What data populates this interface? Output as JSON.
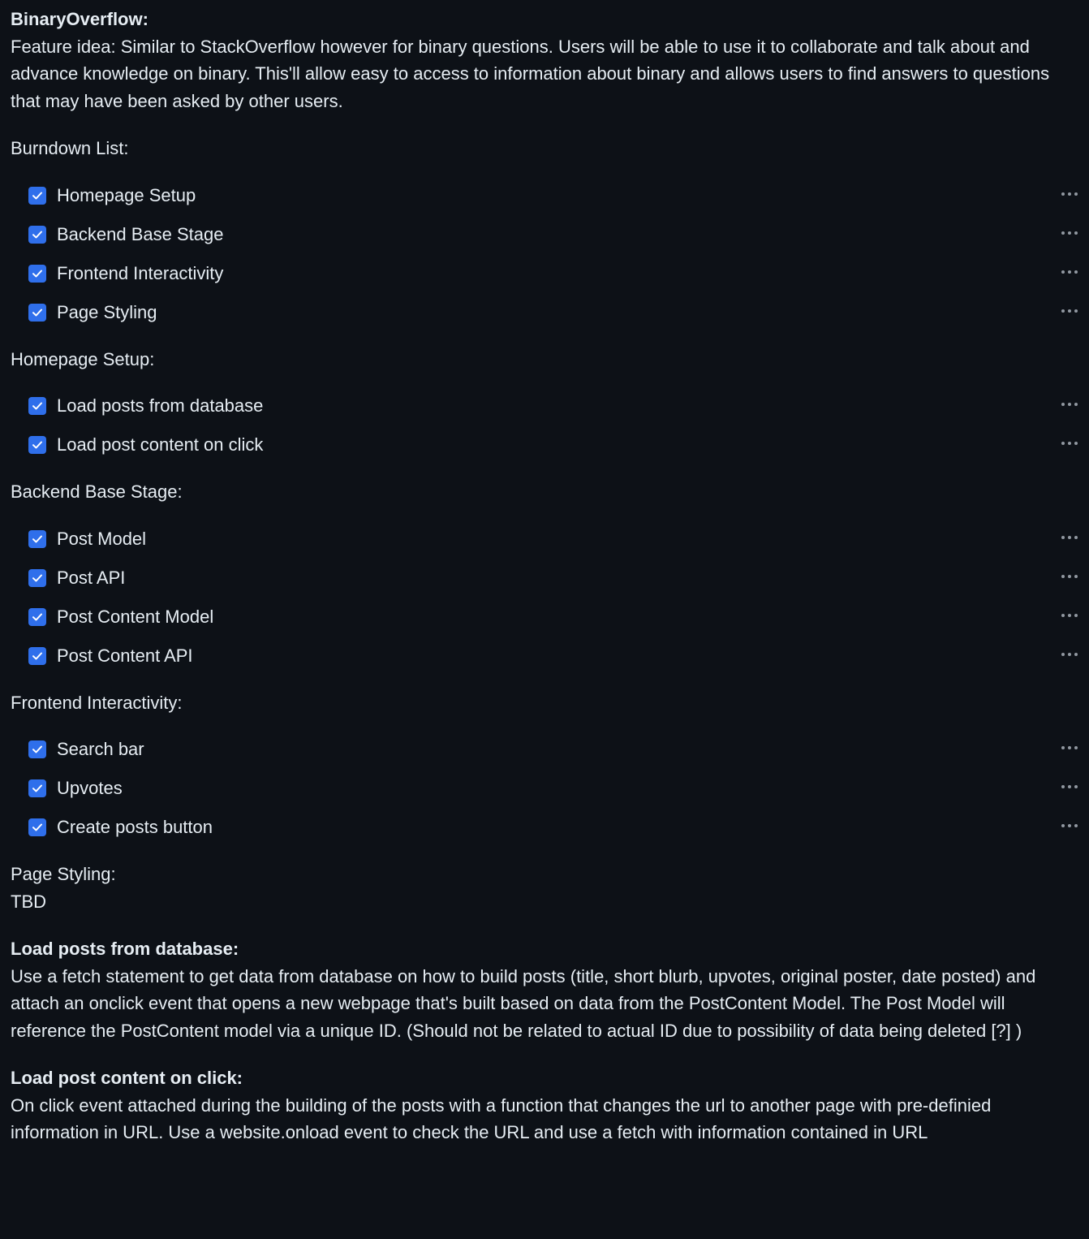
{
  "title": "BinaryOverflow:",
  "feature_idea": "Feature idea: Similar to StackOverflow however for binary questions. Users will be able to use it to collaborate and talk about and advance knowledge on binary. This'll allow easy to access to information about binary and allows users to find answers to questions that may have been asked by other users.",
  "sections": [
    {
      "heading": "Burndown List:",
      "tasks": [
        {
          "label": "Homepage Setup",
          "checked": true
        },
        {
          "label": "Backend Base Stage",
          "checked": true
        },
        {
          "label": "Frontend Interactivity",
          "checked": true
        },
        {
          "label": "Page Styling",
          "checked": true
        }
      ]
    },
    {
      "heading": "Homepage Setup:",
      "tasks": [
        {
          "label": "Load posts from database",
          "checked": true
        },
        {
          "label": "Load post content on click",
          "checked": true
        }
      ]
    },
    {
      "heading": "Backend Base Stage:",
      "tasks": [
        {
          "label": "Post Model",
          "checked": true
        },
        {
          "label": "Post API",
          "checked": true
        },
        {
          "label": "Post Content Model",
          "checked": true
        },
        {
          "label": "Post Content API",
          "checked": true
        }
      ]
    },
    {
      "heading": "Frontend Interactivity:",
      "tasks": [
        {
          "label": "Search bar",
          "checked": true
        },
        {
          "label": "Upvotes",
          "checked": true
        },
        {
          "label": "Create posts button",
          "checked": true
        }
      ]
    }
  ],
  "page_styling": {
    "heading": "Page Styling:",
    "body": "TBD"
  },
  "load_posts": {
    "heading": "Load posts from database:",
    "body": "Use a fetch statement to get data from database on how to build posts (title, short blurb, upvotes, original poster, date posted) and attach an onclick event that opens a new webpage that's built based on data from the PostContent Model. The Post Model will reference the PostContent model via a unique ID. (Should not be related to actual ID due to possibility of data being deleted [?] )"
  },
  "load_content": {
    "heading": "Load post content on click:",
    "body": "On click event attached during the building of the posts with a function that changes the url to another page with pre-definied information in URL. Use a website.onload event to check the URL and use a fetch with information contained in URL"
  },
  "icons": {
    "checkbox": "checkbox-checked-icon",
    "more": "kebab-menu-icon"
  },
  "colors": {
    "background": "#0d1117",
    "text": "#e6edf3",
    "checkbox": "#2f6feb",
    "muted": "#9198a1"
  }
}
